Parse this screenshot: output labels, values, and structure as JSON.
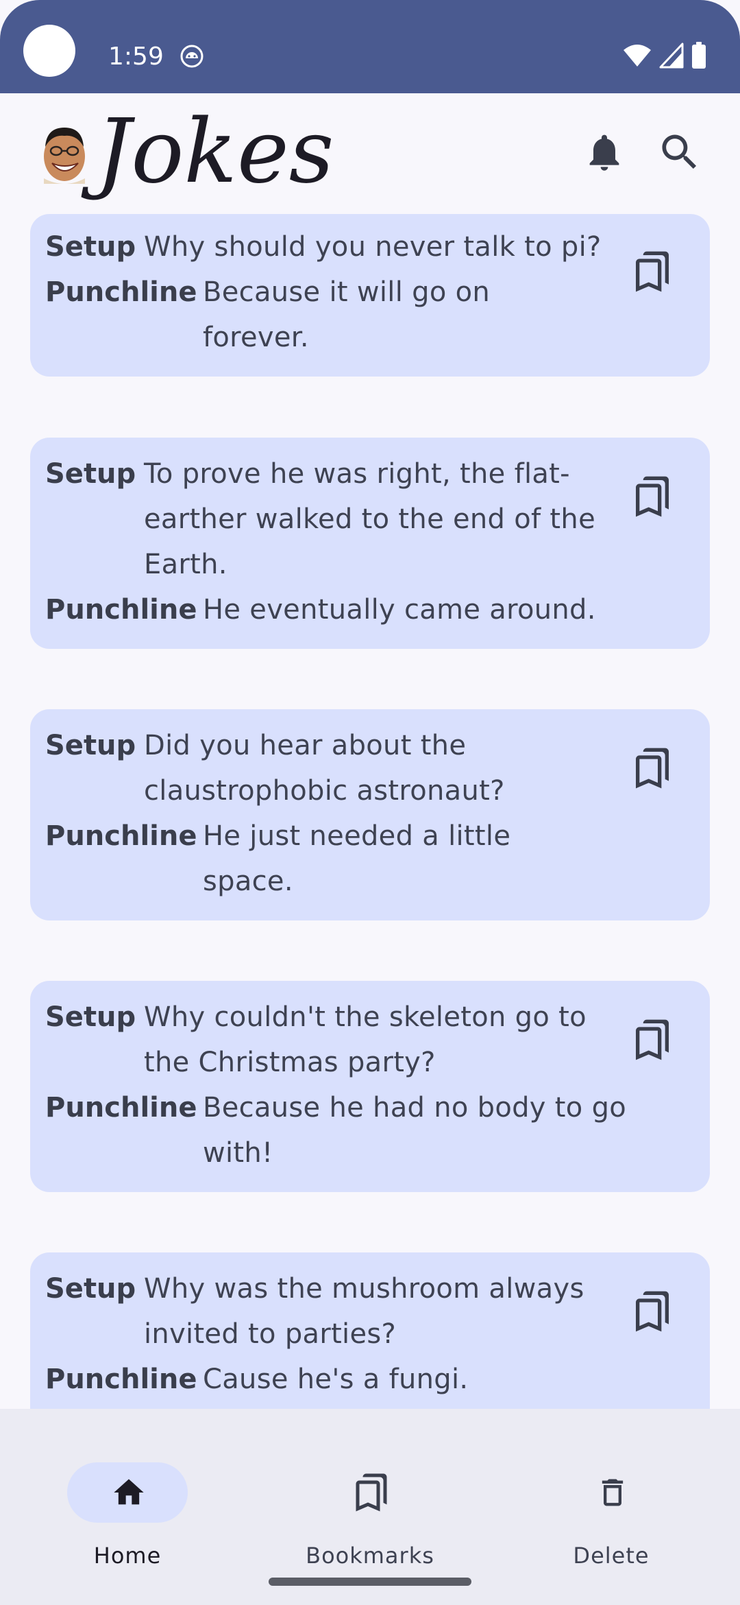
{
  "status_bar": {
    "time": "1:59",
    "icons": [
      "wifi-icon",
      "cellular-signal-icon",
      "battery-icon"
    ],
    "app_notification_icon": "android-icon",
    "background_color": "#4a5a90"
  },
  "app_bar": {
    "title": "Jokes",
    "avatar": "laughing-man-avatar",
    "actions": [
      "bell-icon",
      "search-icon"
    ]
  },
  "jokes": [
    {
      "setup_label": "Setup",
      "setup": "Why should you never talk to pi?",
      "punchline_label": "Punchline",
      "punchline": "Because it will go on forever.",
      "bookmark_icon": "bookmark-outline-icon"
    },
    {
      "setup_label": "Setup",
      "setup": "To prove he was right, the flat-earther walked to the end of the Earth.",
      "punchline_label": "Punchline",
      "punchline": "He eventually came around.",
      "bookmark_icon": "bookmark-outline-icon"
    },
    {
      "setup_label": "Setup",
      "setup": "Did you hear about the claustrophobic astronaut?",
      "punchline_label": "Punchline",
      "punchline": "He just needed a little space.",
      "bookmark_icon": "bookmark-outline-icon"
    },
    {
      "setup_label": "Setup",
      "setup": "Why couldn't the skeleton go to the Christmas party?",
      "punchline_label": "Punchline",
      "punchline": "Because he had no body to go with!",
      "bookmark_icon": "bookmark-outline-icon"
    },
    {
      "setup_label": "Setup",
      "setup": "Why was the mushroom always invited to parties?",
      "punchline_label": "Punchline",
      "punchline": "Cause he's a fungi.",
      "bookmark_icon": "bookmark-outline-icon"
    }
  ],
  "bottom_nav": {
    "items": [
      {
        "label": "Home",
        "icon": "home-icon",
        "selected": true
      },
      {
        "label": "Bookmarks",
        "icon": "bookmarks-icon",
        "selected": false
      },
      {
        "label": "Delete",
        "icon": "trash-icon",
        "selected": false
      }
    ]
  },
  "colors": {
    "card": "#d9e0fd",
    "background": "#f8f7fc",
    "nav_background": "#ebebf3",
    "active_pill": "#d9e0fd"
  }
}
